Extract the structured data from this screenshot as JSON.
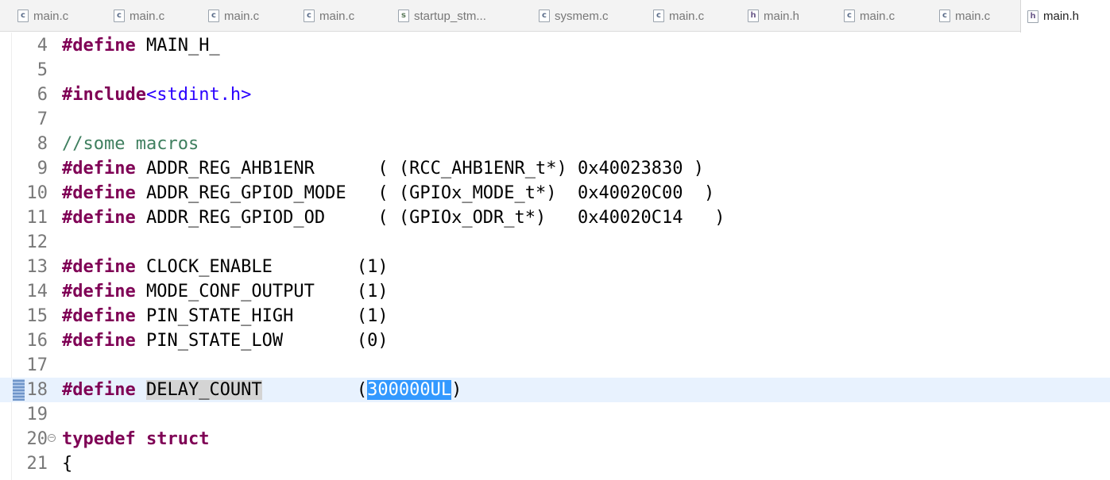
{
  "tabs": [
    {
      "label": "main.c",
      "icon": "c-file-icon",
      "type": "c"
    },
    {
      "label": "main.c",
      "icon": "c-file-icon",
      "type": "c"
    },
    {
      "label": "main.c",
      "icon": "c-file-icon",
      "type": "c"
    },
    {
      "label": "main.c",
      "icon": "c-file-icon",
      "type": "c"
    },
    {
      "label": "startup_stm...",
      "icon": "asm-file-icon",
      "type": "s"
    },
    {
      "label": "sysmem.c",
      "icon": "c-file-icon",
      "type": "c"
    },
    {
      "label": "main.c",
      "icon": "c-file-icon",
      "type": "c"
    },
    {
      "label": "main.h",
      "icon": "h-file-icon",
      "type": "h"
    },
    {
      "label": "main.c",
      "icon": "c-file-icon",
      "type": "c"
    },
    {
      "label": "main.c",
      "icon": "c-file-icon",
      "type": "c"
    },
    {
      "label": "main.h",
      "icon": "h-file-icon",
      "type": "h",
      "active": true
    }
  ],
  "editor": {
    "colors": {
      "keyword": "#7f0055",
      "comment": "#3f7f5f",
      "include_path": "#2a00ff",
      "current_line": "#e8f2fe",
      "selection": "#3399ff"
    },
    "lines": [
      {
        "num": "4",
        "tokens": [
          {
            "t": "#define",
            "c": "kw"
          },
          {
            "t": " MAIN_H_"
          }
        ]
      },
      {
        "num": "5",
        "tokens": []
      },
      {
        "num": "6",
        "tokens": [
          {
            "t": "#include",
            "c": "kw"
          },
          {
            "t": "<stdint.h>",
            "c": "inc"
          }
        ]
      },
      {
        "num": "7",
        "tokens": []
      },
      {
        "num": "8",
        "tokens": [
          {
            "t": "//some macros",
            "c": "cmt"
          }
        ]
      },
      {
        "num": "9",
        "tokens": [
          {
            "t": "#define",
            "c": "kw"
          },
          {
            "t": " ADDR_REG_AHB1ENR      ( (RCC_AHB1ENR_t*) 0x40023830 )"
          }
        ]
      },
      {
        "num": "10",
        "tokens": [
          {
            "t": "#define",
            "c": "kw"
          },
          {
            "t": " ADDR_REG_GPIOD_MODE   ( (GPIOx_MODE_t*)  0x40020C00  )"
          }
        ]
      },
      {
        "num": "11",
        "tokens": [
          {
            "t": "#define",
            "c": "kw"
          },
          {
            "t": " ADDR_REG_GPIOD_OD     ( (GPIOx_ODR_t*)   0x40020C14   )"
          }
        ]
      },
      {
        "num": "12",
        "tokens": []
      },
      {
        "num": "13",
        "tokens": [
          {
            "t": "#define",
            "c": "kw"
          },
          {
            "t": " CLOCK_ENABLE        (1)"
          }
        ]
      },
      {
        "num": "14",
        "tokens": [
          {
            "t": "#define",
            "c": "kw"
          },
          {
            "t": " MODE_CONF_OUTPUT    (1)"
          }
        ]
      },
      {
        "num": "15",
        "tokens": [
          {
            "t": "#define",
            "c": "kw"
          },
          {
            "t": " PIN_STATE_HIGH      (1)"
          }
        ]
      },
      {
        "num": "16",
        "tokens": [
          {
            "t": "#define",
            "c": "kw"
          },
          {
            "t": " PIN_STATE_LOW       (0)"
          }
        ]
      },
      {
        "num": "17",
        "tokens": []
      },
      {
        "num": "18",
        "current": true,
        "tokens": [
          {
            "t": "#define",
            "c": "kw"
          },
          {
            "t": " "
          },
          {
            "t": "DELAY_COUNT",
            "c": "occ"
          },
          {
            "t": "         ("
          },
          {
            "t": "300000UL",
            "c": "sel"
          },
          {
            "t": ")"
          }
        ]
      },
      {
        "num": "19",
        "tokens": []
      },
      {
        "num": "20",
        "fold": true,
        "tokens": [
          {
            "t": "typedef",
            "c": "kw"
          },
          {
            "t": " "
          },
          {
            "t": "struct",
            "c": "kw"
          }
        ]
      },
      {
        "num": "21",
        "tokens": [
          {
            "t": "{"
          }
        ]
      }
    ]
  }
}
